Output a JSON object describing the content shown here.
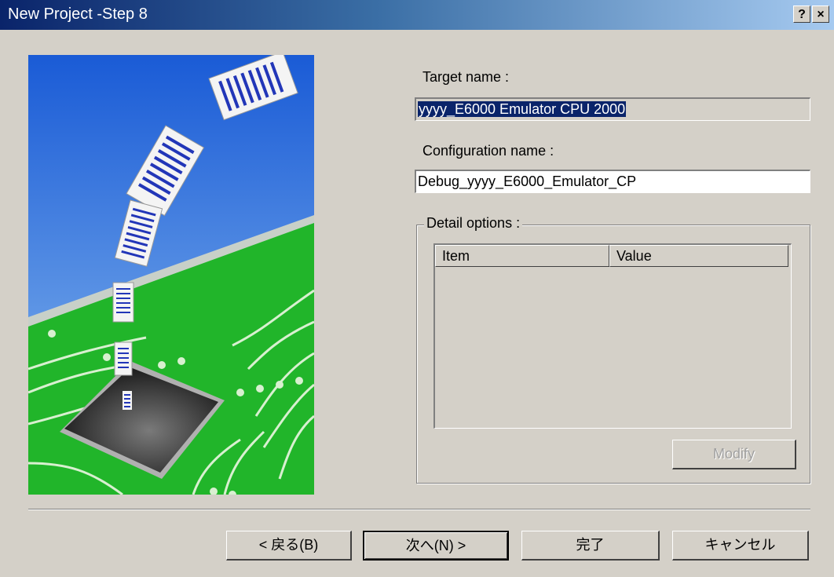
{
  "window": {
    "title": "New Project -Step 8",
    "help_glyph": "?",
    "close_glyph": "×"
  },
  "form": {
    "target_label": "Target name :",
    "target_value": "yyyy_E6000 Emulator CPU 2000",
    "config_label": "Configuration name :",
    "config_value": "Debug_yyyy_E6000_Emulator_CP",
    "detail_legend": "Detail options :",
    "columns": [
      "Item",
      "Value"
    ],
    "modify_label": "Modify"
  },
  "buttons": {
    "back": "< 戻る(B)",
    "next": "次へ(N) >",
    "finish": "完了",
    "cancel": "キャンセル"
  },
  "colors": {
    "dialog_bg": "#d4d0c8",
    "selection": "#0a246a",
    "sky_top": "#1a5bd6",
    "board_green": "#21b52a"
  }
}
